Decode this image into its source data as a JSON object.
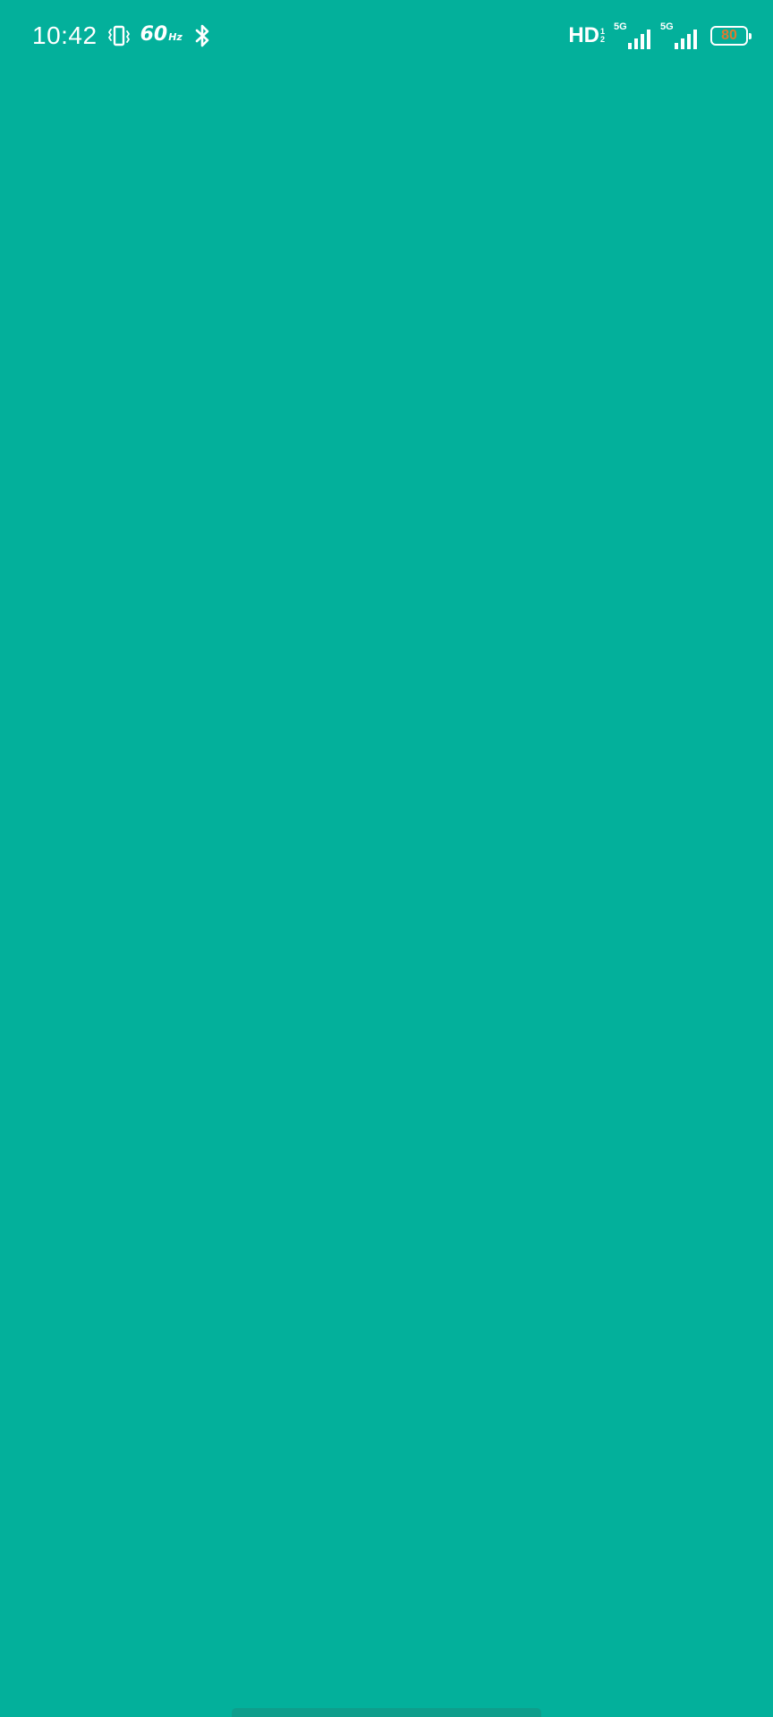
{
  "status_bar": {
    "time": "10:42",
    "refresh_rate": {
      "value": "60",
      "unit": "Hz"
    },
    "network_badge": {
      "main": "HD",
      "super": "1",
      "sub": "2"
    },
    "signal_1": {
      "label": "5G",
      "bars": 4
    },
    "signal_2": {
      "label": "5G",
      "bars": 4
    },
    "battery": {
      "percent": "80",
      "level": 0.8
    }
  },
  "colors": {
    "background": "#03B09B",
    "home_indicator": "#0E9E8C",
    "battery_text": "#E07A2E"
  },
  "icons": {
    "vibrate": "vibrate-icon",
    "bluetooth": "bluetooth-icon"
  }
}
